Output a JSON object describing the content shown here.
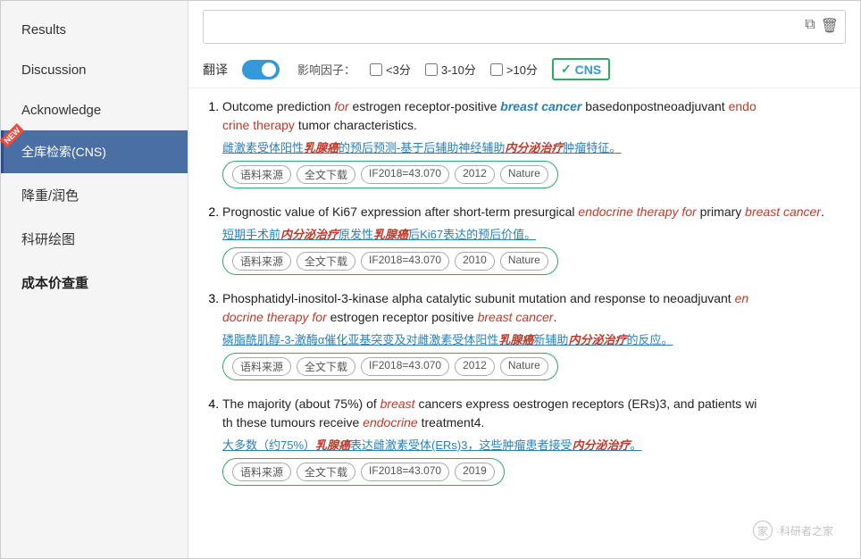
{
  "sidebar": {
    "items": [
      {
        "label": "Results",
        "id": "results",
        "active": false
      },
      {
        "label": "Discussion",
        "id": "discussion",
        "active": false
      },
      {
        "label": "Acknowledge",
        "id": "acknowledge",
        "active": false
      },
      {
        "label": "全库检索(CNS)",
        "id": "cns-search",
        "active": true,
        "new": true
      },
      {
        "label": "降重/润色",
        "id": "rewrite",
        "active": false
      },
      {
        "label": "科研绘图",
        "id": "drawing",
        "active": false
      },
      {
        "label": "成本价查重",
        "id": "cost-check",
        "active": false,
        "bold": true
      }
    ]
  },
  "filter": {
    "translate_label": "翻译",
    "influence_label": "影响因子：",
    "option1_label": "<3分",
    "option2_label": "3-10分",
    "option3_label": ">10分",
    "cns_label": "CNS",
    "cns_checked": true
  },
  "results": [
    {
      "index": 1,
      "title_parts": [
        {
          "text": "Outcome prediction ",
          "style": "normal"
        },
        {
          "text": "for",
          "style": "italic-red"
        },
        {
          "text": " estrogen receptor-positive ",
          "style": "normal"
        },
        {
          "text": "breast cancer",
          "style": "italic-blue-bold"
        },
        {
          "text": " basedonpostneoadjuvant ",
          "style": "normal"
        },
        {
          "text": "endo",
          "style": "red-text"
        },
        {
          "text": "\ncrine therapy",
          "style": "red-text"
        },
        {
          "text": " tumor characteristics.",
          "style": "normal"
        }
      ],
      "title_full": "Outcome prediction for estrogen receptor-positive breast cancer basedonpostneoadjuvant endocrine therapy tumor characteristics.",
      "chinese": "雌激素受体阳性乳腺癌的预后预测-基于后辅助内分泌治疗肿瘤特征。",
      "tags": [
        "语料来源",
        "全文下载",
        "IF2018=43.070",
        "2012",
        "Nature"
      ]
    },
    {
      "index": 2,
      "title_full": "Prognostic value of Ki67 expression after short-term presurgical endocrine therapy for primary breast cancer.",
      "chinese": "短期手术前内分泌治疗原发性乳腺癌后Ki67表达的预后价值。",
      "tags": [
        "语料来源",
        "全文下载",
        "IF2018=43.070",
        "2010",
        "Nature"
      ]
    },
    {
      "index": 3,
      "title_full": "Phosphatidyl-inositol-3-kinase alpha catalytic subunit mutation and response to neoadjuvant endocrine therapy for estrogen receptor positive breast cancer.",
      "chinese": "磷脂酰肌醇-3-激酶α催化亚基突变及对雌激素受体阳性乳腺癌新辅助内分泌治疗的反应。",
      "tags": [
        "语料来源",
        "全文下载",
        "IF2018=43.070",
        "2012",
        "Nature"
      ]
    },
    {
      "index": 4,
      "title_full": "The majority (about 75%) of breast cancers express oestrogen receptors (ERs)3, and patients with these tumours receive endocrine treatment4.",
      "chinese": "大多数（约75%）乳腺癌表达雌激素受体(ERs)3，这些肿瘤患者接受内分泌治疗。",
      "tags": [
        "语料来源",
        "全文下载",
        "IF2018=43.070",
        "2019"
      ]
    }
  ],
  "icons": {
    "copy": "⧉",
    "delete": "🗑"
  },
  "watermark": {
    "text": "·科研者之家",
    "icon_label": "家"
  }
}
